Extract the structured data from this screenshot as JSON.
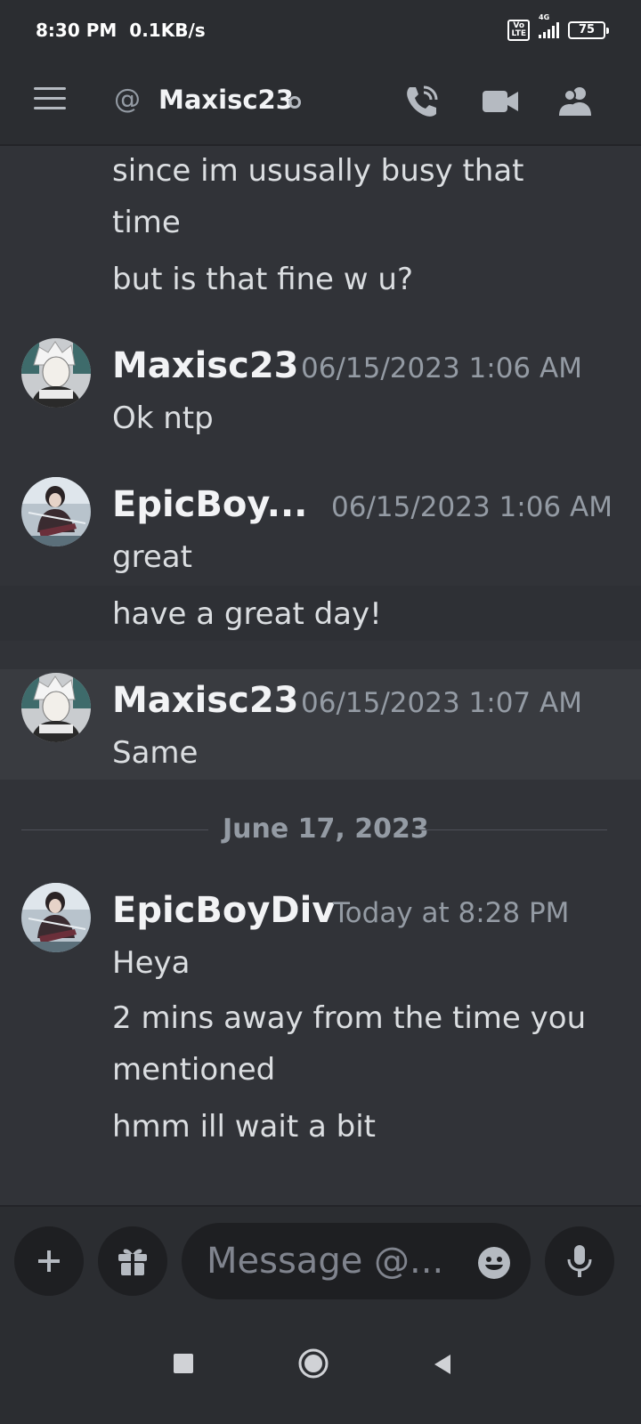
{
  "status_bar": {
    "time": "8:30 PM",
    "speed": "0.1KB/s",
    "volte_line1": "Vo",
    "volte_line2": "LTE",
    "network": "4G",
    "battery": "75"
  },
  "header": {
    "channel_prefix_icon": "at-icon",
    "channel_name": "Maxisc23",
    "icons": [
      "hamburger-icon",
      "call-icon",
      "video-icon",
      "members-icon"
    ]
  },
  "messages": {
    "continued_lines": [
      "since im ususally busy that",
      "time",
      "but is that fine w u?"
    ],
    "groups": [
      {
        "author": "Maxisc23",
        "timestamp": "06/15/2023 1:06 AM",
        "lines": [
          "Ok ntp"
        ]
      },
      {
        "author": "EpicBoy...",
        "timestamp": "06/15/2023 1:06 AM",
        "lines": [
          "great",
          "have a great day!"
        ]
      },
      {
        "author": "Maxisc23",
        "timestamp": "06/15/2023 1:07 AM",
        "lines": [
          "Same"
        ]
      },
      {
        "author": "EpicBoyDiv",
        "timestamp": "Today at 8:28 PM",
        "lines": [
          "Heya",
          "2 mins away from the time you",
          "mentioned",
          "hmm ill wait a bit"
        ]
      }
    ],
    "date_divider": "June 17, 2023"
  },
  "composer": {
    "placeholder": "Message @...",
    "icons": [
      "plus-icon",
      "gift-icon",
      "emoji-icon",
      "microphone-icon"
    ]
  },
  "navbar": {
    "icons": [
      "recents-icon",
      "home-icon",
      "back-icon"
    ]
  },
  "colors": {
    "background": "#313338",
    "header": "#2b2d31",
    "text": "#dbdee1",
    "muted": "#949ba4",
    "input": "#1e1f22"
  }
}
